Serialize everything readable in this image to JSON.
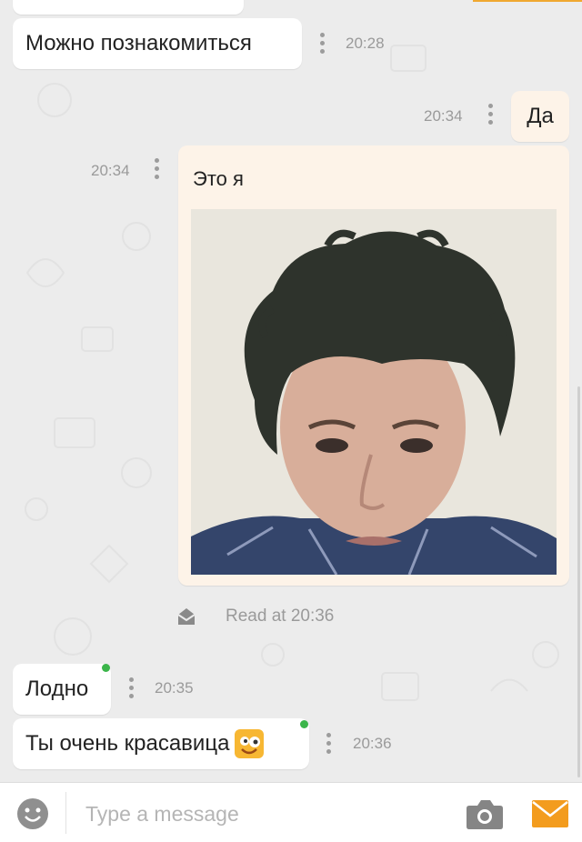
{
  "messages": [
    {
      "id": "m1",
      "direction": "in",
      "text": "Можно познакомиться",
      "time": "20:28"
    },
    {
      "id": "m2",
      "direction": "out",
      "text": "Да",
      "time": "20:34"
    },
    {
      "id": "m3",
      "direction": "out",
      "text": "Это я",
      "time": "20:34",
      "attachment": "photo"
    },
    {
      "id": "m4",
      "direction": "in",
      "text": "Лодно",
      "time": "20:35"
    },
    {
      "id": "m5",
      "direction": "in",
      "text": "Ты очень красавица",
      "time": "20:36",
      "emoji": "winking-smiley"
    }
  ],
  "read_receipt": {
    "text": "Read at 20:36",
    "icon": "envelope-open-icon"
  },
  "composer": {
    "placeholder": "Type a message"
  },
  "colors": {
    "background": "#ececec",
    "incoming_bubble": "#ffffff",
    "outgoing_bubble": "#fdf3e8",
    "accent": "#f39c1e",
    "online": "#3bb54a"
  }
}
